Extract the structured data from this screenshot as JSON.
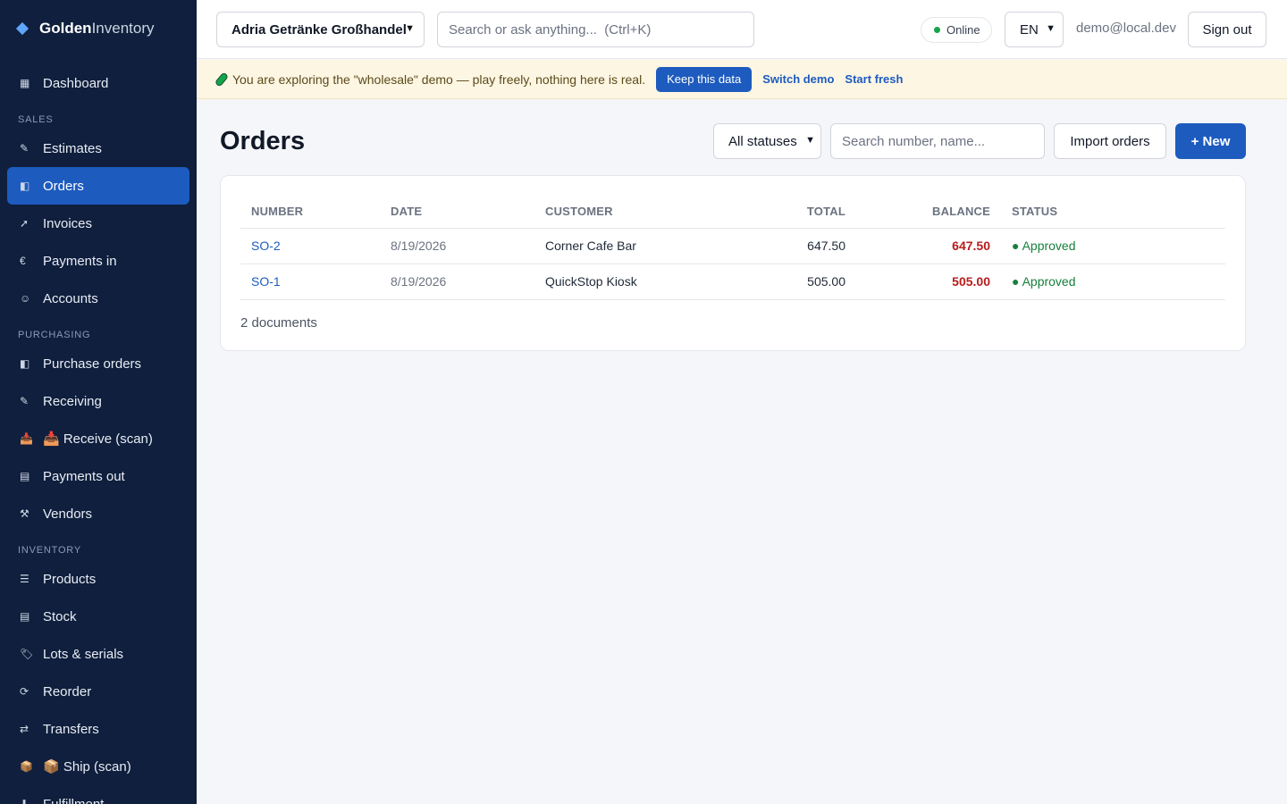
{
  "brand": {
    "part1": "Golden",
    "part2": "Inventory"
  },
  "sidebar": {
    "top": [
      {
        "icon": "▦",
        "label": "Dashboard"
      }
    ],
    "sections": [
      {
        "title": "SALES",
        "items": [
          {
            "icon": "✎",
            "label": "Estimates"
          },
          {
            "icon": "◧",
            "label": "Orders"
          },
          {
            "icon": "➚",
            "label": "Invoices"
          },
          {
            "icon": "€",
            "label": "Payments in"
          },
          {
            "icon": "☺",
            "label": "Accounts"
          }
        ]
      },
      {
        "title": "PURCHASING",
        "items": [
          {
            "icon": "◧",
            "label": "Purchase orders"
          },
          {
            "icon": "✎",
            "label": "Receiving"
          },
          {
            "icon": "📥",
            "label": "📥 Receive (scan)"
          },
          {
            "icon": "▤",
            "label": "Payments out"
          },
          {
            "icon": "⚒",
            "label": "Vendors"
          }
        ]
      },
      {
        "title": "INVENTORY",
        "items": [
          {
            "icon": "☰",
            "label": "Products"
          },
          {
            "icon": "▤",
            "label": "Stock"
          },
          {
            "icon": "🏷",
            "label": "Lots & serials"
          },
          {
            "icon": "⟳",
            "label": "Reorder"
          },
          {
            "icon": "⇄",
            "label": "Transfers"
          },
          {
            "icon": "📦",
            "label": "📦 Ship (scan)"
          },
          {
            "icon": "⬇",
            "label": "Fulfillment"
          }
        ]
      }
    ]
  },
  "topbar": {
    "company": "Adria Getränke Großhandel",
    "search_placeholder": "Search or ask anything...  (Ctrl+K)",
    "status": "Online",
    "language": "EN",
    "user_email": "demo@local.dev",
    "signout_label": "Sign out"
  },
  "banner": {
    "text": "You are exploring the \"wholesale\" demo — play freely, nothing here is real.",
    "keep_label": "Keep this data",
    "switch_label": "Switch demo",
    "fresh_label": "Start fresh"
  },
  "main": {
    "title": "Orders",
    "status_filter": "All statuses",
    "search_placeholder": "Search number, name...",
    "import_label": "Import orders",
    "new_label": "+ New",
    "columns": {
      "number": "NUMBER",
      "date": "DATE",
      "customer": "CUSTOMER",
      "total": "TOTAL",
      "balance": "BALANCE",
      "status": "STATUS"
    },
    "rows": [
      {
        "number": "SO-2",
        "date": "8/19/2026",
        "customer": "Corner Cafe Bar",
        "total": "647.50",
        "balance": "647.50",
        "status": "● Approved"
      },
      {
        "number": "SO-1",
        "date": "8/19/2026",
        "customer": "QuickStop Kiosk",
        "total": "505.00",
        "balance": "505.00",
        "status": "● Approved"
      }
    ],
    "doc_count": "2 documents"
  },
  "colors": {
    "sidebar_bg": "#0f1f3d",
    "accent": "#1d5bbf",
    "balance_red": "#b91c1c",
    "status_green": "#16803c",
    "banner_bg": "#fdf6e3"
  }
}
